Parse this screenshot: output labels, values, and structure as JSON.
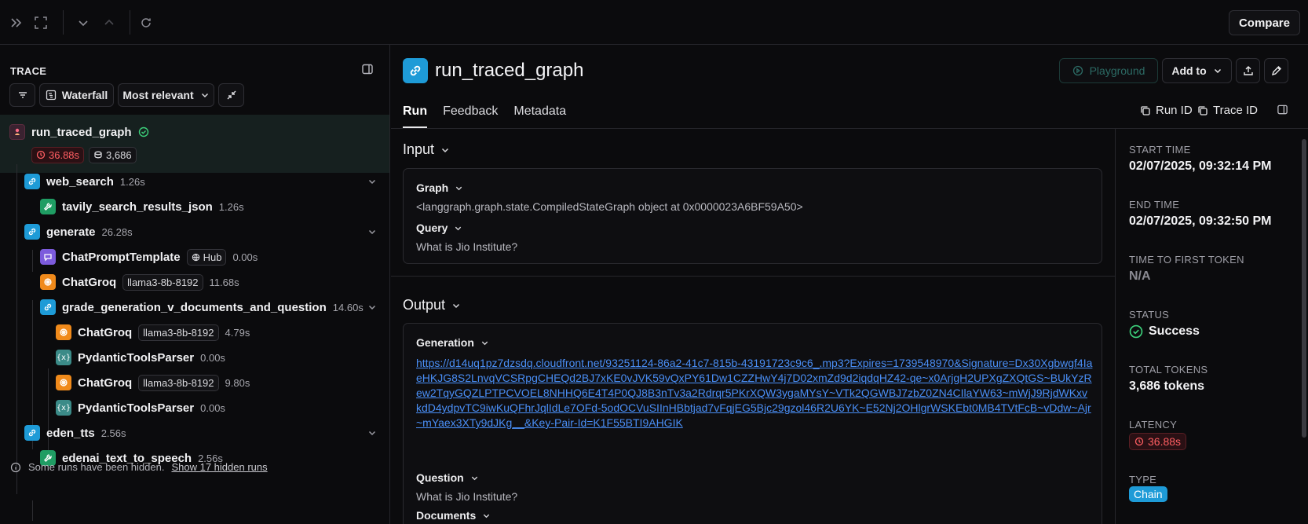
{
  "topbar": {
    "compare_label": "Compare"
  },
  "trace": {
    "heading": "TRACE",
    "view_mode": "Waterfall",
    "sort": "Most relevant",
    "root": {
      "name": "run_traced_graph",
      "latency": "36.88s",
      "tokens": "3,686"
    },
    "nodes": [
      {
        "name": "web_search",
        "time": "1.26s",
        "icon": "chain-link-icon"
      },
      {
        "name": "tavily_search_results_json",
        "time": "1.26s",
        "icon": "wrench-icon"
      },
      {
        "name": "generate",
        "time": "26.28s",
        "icon": "chain-link-icon"
      },
      {
        "name": "ChatPromptTemplate",
        "chip": "Hub",
        "time": "0.00s",
        "icon": "prompt-icon"
      },
      {
        "name": "ChatGroq",
        "chip": "llama3-8b-8192",
        "time": "11.68s",
        "icon": "llm-icon"
      },
      {
        "name": "grade_generation_v_documents_and_question",
        "time": "14.60s",
        "icon": "chain-link-icon"
      },
      {
        "name": "ChatGroq",
        "chip": "llama3-8b-8192",
        "time": "4.79s",
        "icon": "llm-icon"
      },
      {
        "name": "PydanticToolsParser",
        "time": "0.00s",
        "icon": "parser-icon"
      },
      {
        "name": "ChatGroq",
        "chip": "llama3-8b-8192",
        "time": "9.80s",
        "icon": "llm-icon"
      },
      {
        "name": "PydanticToolsParser",
        "time": "0.00s",
        "icon": "parser-icon"
      },
      {
        "name": "eden_tts",
        "time": "2.56s",
        "icon": "chain-link-icon"
      },
      {
        "name": "edenai_text_to_speech",
        "time": "2.56s",
        "icon": "wrench-icon"
      }
    ],
    "hidden_note": "Some runs have been hidden.",
    "hidden_link": "Show 17 hidden runs"
  },
  "run": {
    "title": "run_traced_graph",
    "playground": "Playground",
    "add_to": "Add to",
    "tabs": [
      "Run",
      "Feedback",
      "Metadata"
    ],
    "run_id": "Run ID",
    "trace_id": "Trace ID"
  },
  "input": {
    "title": "Input",
    "graph_label": "Graph",
    "graph_value": "<langgraph.graph.state.CompiledStateGraph object at 0x0000023A6BF59A50>",
    "query_label": "Query",
    "query_value": "What is Jio Institute?"
  },
  "output": {
    "title": "Output",
    "generation_label": "Generation",
    "generation_url": "https://d14uq1pz7dzsdq.cloudfront.net/93251124-86a2-41c7-815b-43191723c9c6_.mp3?Expires=1739548970&Signature=Dx30Xgbwgf4IaeHKJG8S2LnvqVCSRpgCHEQd2BJ7xKE0vJVK59vQxPY61Dw1CZZHwY4j7D02xmZd9d2iqdqHZ42-qe~x0ArjgH2UPXgZXQtGS~BUkYzRew2TqyGQZLPTPCVOEL8NHHQ6E4T4P0QJ8B3nTv3a2Rdrqr5PKrXQW3ygaMYsY~VTk2QGWBJ7zbZ0ZN4CIlaYW63~mWjJ9RjdWKxvkdD4ydpvTC9iwKuQFhrJqlIdLe7OFd-5odOCVuSIInHBbtjad7vFqjEG5Bjc29gzol46R2U6YK~E52Nj2OHlgrWSKEbt0MB4TVtFcB~vDdw~Ajr~mYaex3XTy9dJKg__&Key-Pair-Id=K1F55BTI9AHGIK",
    "question_label": "Question",
    "question_value": "What is Jio Institute?",
    "documents_label": "Documents"
  },
  "meta": {
    "start_time_label": "START TIME",
    "start_time": "02/07/2025, 09:32:14 PM",
    "end_time_label": "END TIME",
    "end_time": "02/07/2025, 09:32:50 PM",
    "ttft_label": "TIME TO FIRST TOKEN",
    "ttft": "N/A",
    "status_label": "STATUS",
    "status": "Success",
    "tokens_label": "TOTAL TOKENS",
    "tokens": "3,686 tokens",
    "latency_label": "LATENCY",
    "latency": "36.88s",
    "type_label": "TYPE",
    "type": "Chain"
  },
  "colors": {
    "chain": "#1e9bd7",
    "tool": "#1f9d63",
    "llm": "#f08a1b",
    "prompt": "#7c5bdc",
    "parser": "#3b8b88",
    "error": "#ff5e62",
    "success": "#3ccf7a",
    "link": "#4a8ff7"
  }
}
